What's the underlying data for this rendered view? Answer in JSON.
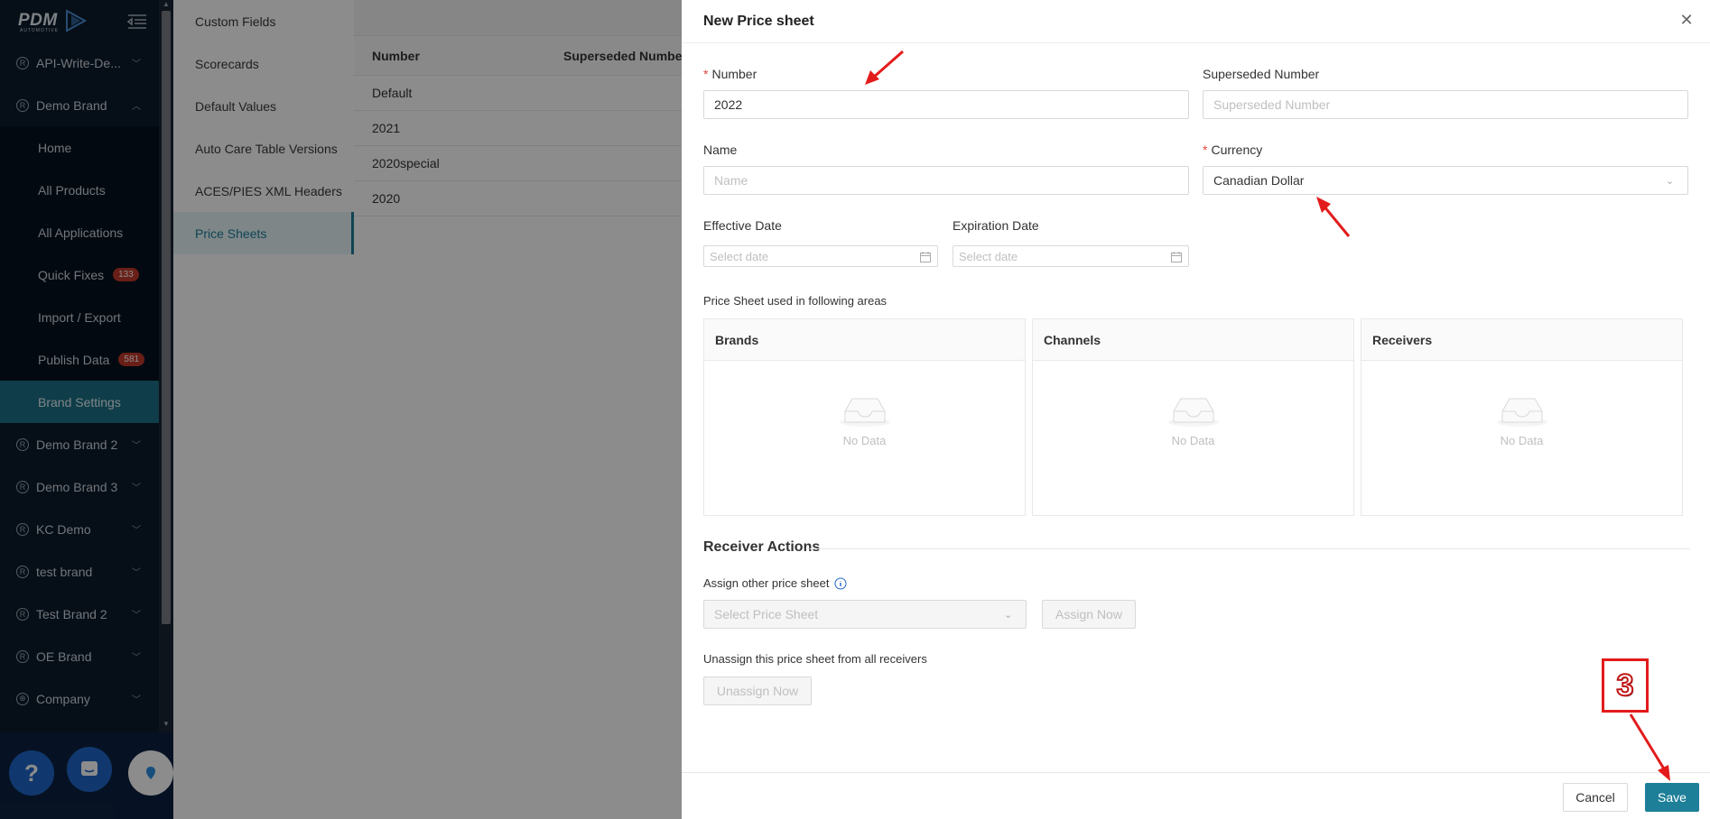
{
  "sidebar": {
    "logo_text": "PDM",
    "logo_sub": "AUTOMOTIVE",
    "items": [
      {
        "label": "API-Write-De...",
        "type": "brand"
      },
      {
        "label": "Demo Brand",
        "type": "brand-open"
      },
      {
        "label": "Home",
        "type": "sub"
      },
      {
        "label": "All Products",
        "type": "sub"
      },
      {
        "label": "All Applications",
        "type": "sub"
      },
      {
        "label": "Quick Fixes",
        "type": "sub",
        "badge": "133"
      },
      {
        "label": "Import / Export",
        "type": "sub"
      },
      {
        "label": "Publish Data",
        "type": "sub",
        "badge": "581"
      },
      {
        "label": "Brand Settings",
        "type": "active"
      },
      {
        "label": "Demo Brand 2",
        "type": "brand"
      },
      {
        "label": "Demo Brand 3",
        "type": "brand"
      },
      {
        "label": "KC Demo",
        "type": "brand"
      },
      {
        "label": "test brand",
        "type": "brand"
      },
      {
        "label": "Test Brand 2",
        "type": "brand"
      },
      {
        "label": "OE Brand",
        "type": "brand"
      },
      {
        "label": "Company",
        "type": "company"
      }
    ]
  },
  "settings_menu": {
    "items": [
      "Custom Fields",
      "Scorecards",
      "Default Values",
      "Auto Care Table Versions",
      "ACES/PIES XML Headers",
      "Price Sheets"
    ],
    "active": "Price Sheets"
  },
  "table": {
    "columns": [
      "Number",
      "Superseded Number"
    ],
    "rows": [
      "Default",
      "2021",
      "2020special",
      "2020"
    ]
  },
  "drawer": {
    "title": "New Price sheet",
    "number_label": "Number",
    "number_value": "2022",
    "superseded_label": "Superseded Number",
    "superseded_placeholder": "Superseded Number",
    "name_label": "Name",
    "name_placeholder": "Name",
    "currency_label": "Currency",
    "currency_value": "Canadian Dollar",
    "effective_label": "Effective Date",
    "expiration_label": "Expiration Date",
    "date_placeholder": "Select date",
    "areas_label": "Price Sheet used in following areas",
    "panels": [
      "Brands",
      "Channels",
      "Receivers"
    ],
    "no_data": "No Data",
    "receiver_actions": "Receiver Actions",
    "assign_label": "Assign other price sheet",
    "select_placeholder": "Select Price Sheet",
    "assign_button": "Assign Now",
    "unassign_label": "Unassign this price sheet from all receivers",
    "unassign_button": "Unassign Now",
    "cancel_button": "Cancel",
    "save_button": "Save"
  },
  "annotation": {
    "step": "3",
    "color": "#e31b1b"
  }
}
